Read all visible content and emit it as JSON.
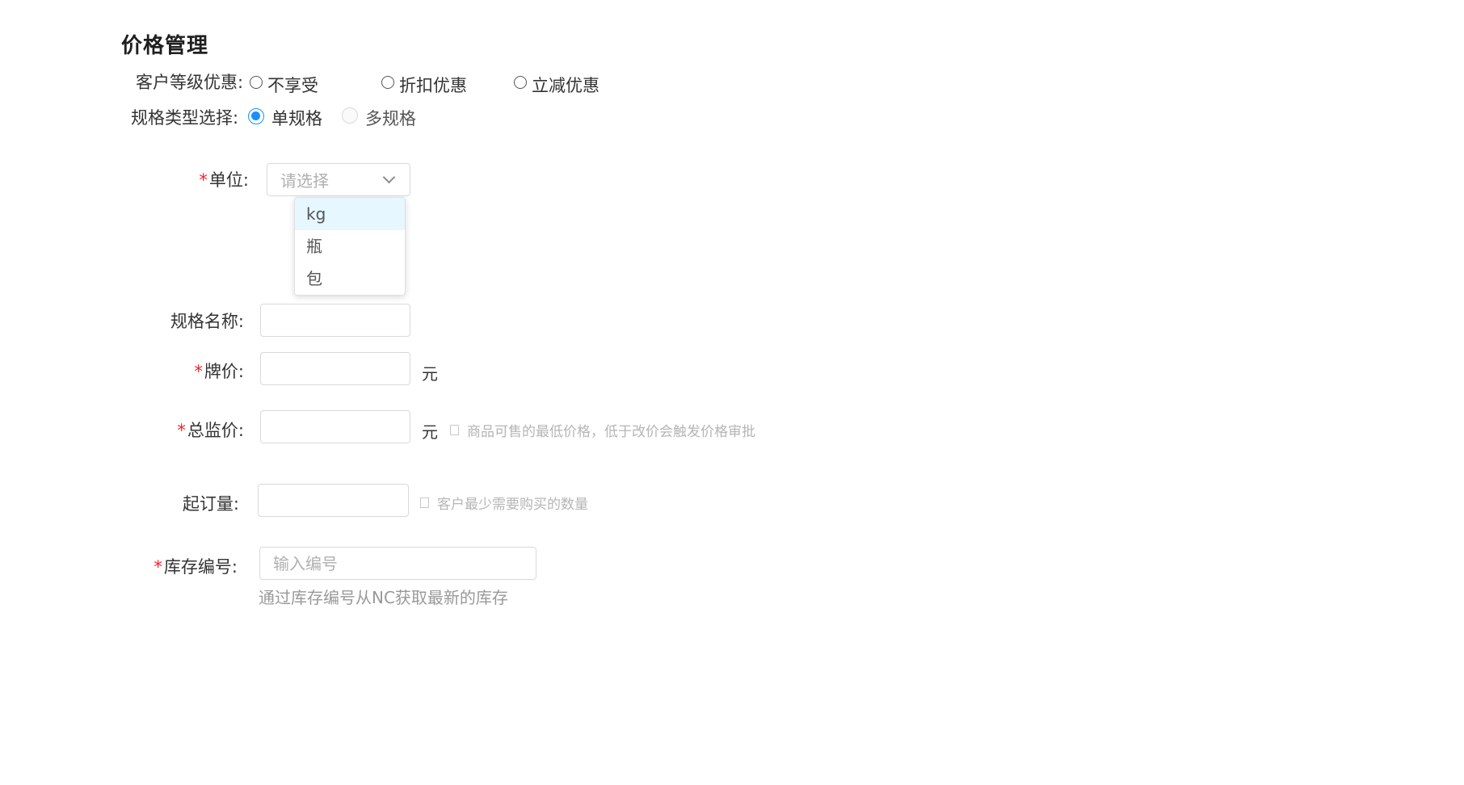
{
  "section": {
    "title": "价格管理"
  },
  "customer_level": {
    "label": "客户等级优惠:",
    "options": [
      "不享受",
      "折扣优惠",
      "立减优惠"
    ]
  },
  "spec_type": {
    "label": "规格类型选择:",
    "options": [
      "单规格",
      "多规格"
    ],
    "selected": "单规格",
    "disabled": [
      "多规格"
    ]
  },
  "unit": {
    "label": "单位:",
    "placeholder": "请选择",
    "options": [
      "kg",
      "瓶",
      "包"
    ],
    "highlighted": "kg",
    "dropdown_open": true
  },
  "spec_name": {
    "label": "规格名称:",
    "value": ""
  },
  "list_price": {
    "label": "牌价:",
    "value": "",
    "unit": "元"
  },
  "min_price": {
    "label": "总监价:",
    "value": "",
    "unit": "元",
    "hint": "商品可售的最低价格，低于改价会触发价格审批"
  },
  "min_order": {
    "label": "起订量:",
    "value": "",
    "hint": "客户最少需要购买的数量"
  },
  "stock_code": {
    "label": "库存编号:",
    "placeholder": "输入编号",
    "value": "",
    "help": "通过库存编号从NC获取最新的库存"
  },
  "colors": {
    "primary": "#1890ff",
    "required": "#f5222d",
    "border": "#d9d9d9",
    "dropdown_highlight": "#e6f7ff",
    "hint_text": "#b5b5b5"
  }
}
